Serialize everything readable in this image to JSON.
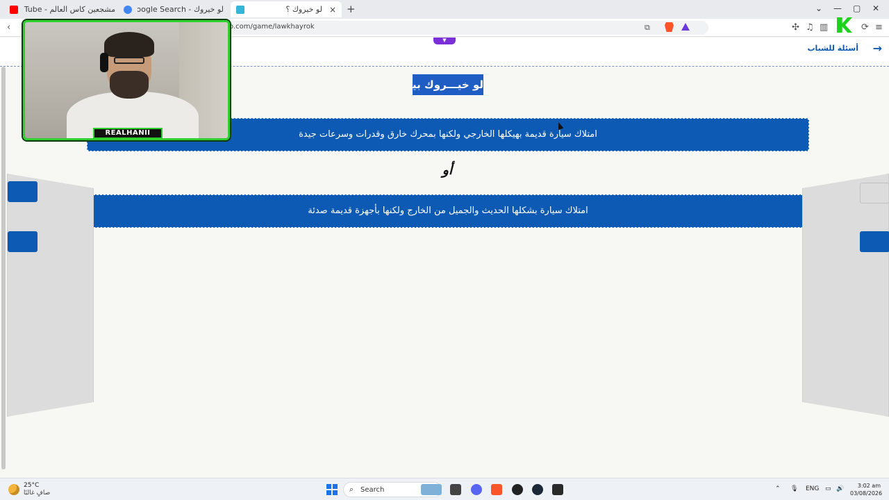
{
  "tabs": [
    {
      "title": "مشجعين كاس العالم - YouTube",
      "favicon": "youtube-icon",
      "color": "#ff0000"
    },
    {
      "title": "لو خيروك - Google Search",
      "favicon": "google-icon",
      "color": "#4285f4"
    },
    {
      "title": "لو خيروك ؟",
      "favicon": "site-icon",
      "color": "#35b6d8",
      "active": true,
      "close": "×"
    }
  ],
  "new_tab": "+",
  "window_controls": {
    "minimize": "⌄",
    "min2": "—",
    "max": "▢",
    "close": "✕"
  },
  "toolbar": {
    "back": "‹",
    "url": "o.com/game/lawkhayrok"
  },
  "page": {
    "back_arrow": "→",
    "breadcrumb": "أسئلة للشباب",
    "dropper": "▼",
    "heading": "لو خيـــروك بين",
    "option1": "امتلاك سيارة قديمة بهيكلها الخارجي ولكنها بمحرك خارق وقدرات وسرعات جيدة",
    "or": "أو",
    "option2": "امتلاك سيارة بشكلها الحديث والجميل من الخارج ولكنها بأجهزة قديمة صدئة"
  },
  "overlay": {
    "streamer": "REALHANII"
  },
  "taskbar": {
    "temp": "25°C",
    "weather": "صافٍ غالبًا",
    "search": "Search",
    "lang": "ENG",
    "time": "3:02 am",
    "date": "03/08/2026"
  }
}
